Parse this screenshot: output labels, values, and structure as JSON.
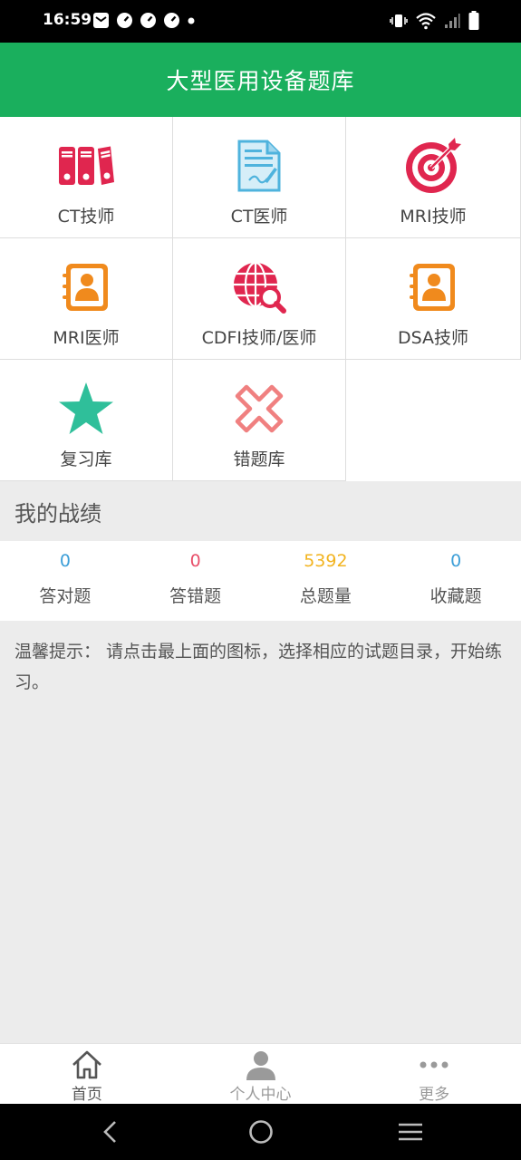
{
  "status_bar": {
    "time": "16:59"
  },
  "header": {
    "title": "大型医用设备题库"
  },
  "grid": {
    "items": [
      {
        "label": "CT技师",
        "icon": "binders-icon"
      },
      {
        "label": "CT医师",
        "icon": "document-icon"
      },
      {
        "label": "MRI技师",
        "icon": "target-icon"
      },
      {
        "label": "MRI医师",
        "icon": "contact-book-icon"
      },
      {
        "label": "CDFI技师/医师",
        "icon": "globe-search-icon"
      },
      {
        "label": "DSA技师",
        "icon": "contact-book-icon"
      },
      {
        "label": "复习库",
        "icon": "star-icon"
      },
      {
        "label": "错题库",
        "icon": "cross-icon"
      }
    ]
  },
  "record": {
    "title": "我的战绩",
    "stats": [
      {
        "value": "0",
        "label": "答对题",
        "color": "#3d9fd8"
      },
      {
        "value": "0",
        "label": "答错题",
        "color": "#e8506a"
      },
      {
        "value": "5392",
        "label": "总题量",
        "color": "#f2b420"
      },
      {
        "value": "0",
        "label": "收藏题",
        "color": "#3d9fd8"
      }
    ]
  },
  "tip": {
    "text": "温馨提示： 请点击最上面的图标，选择相应的试题目录，开始练习。"
  },
  "bottom_nav": {
    "items": [
      {
        "label": "首页",
        "active": true
      },
      {
        "label": "个人中心",
        "active": false
      },
      {
        "label": "更多",
        "active": false
      }
    ]
  },
  "colors": {
    "brand": "#1aaf5d",
    "active_nav": "#555555",
    "inactive_nav": "#9a9a9a"
  }
}
